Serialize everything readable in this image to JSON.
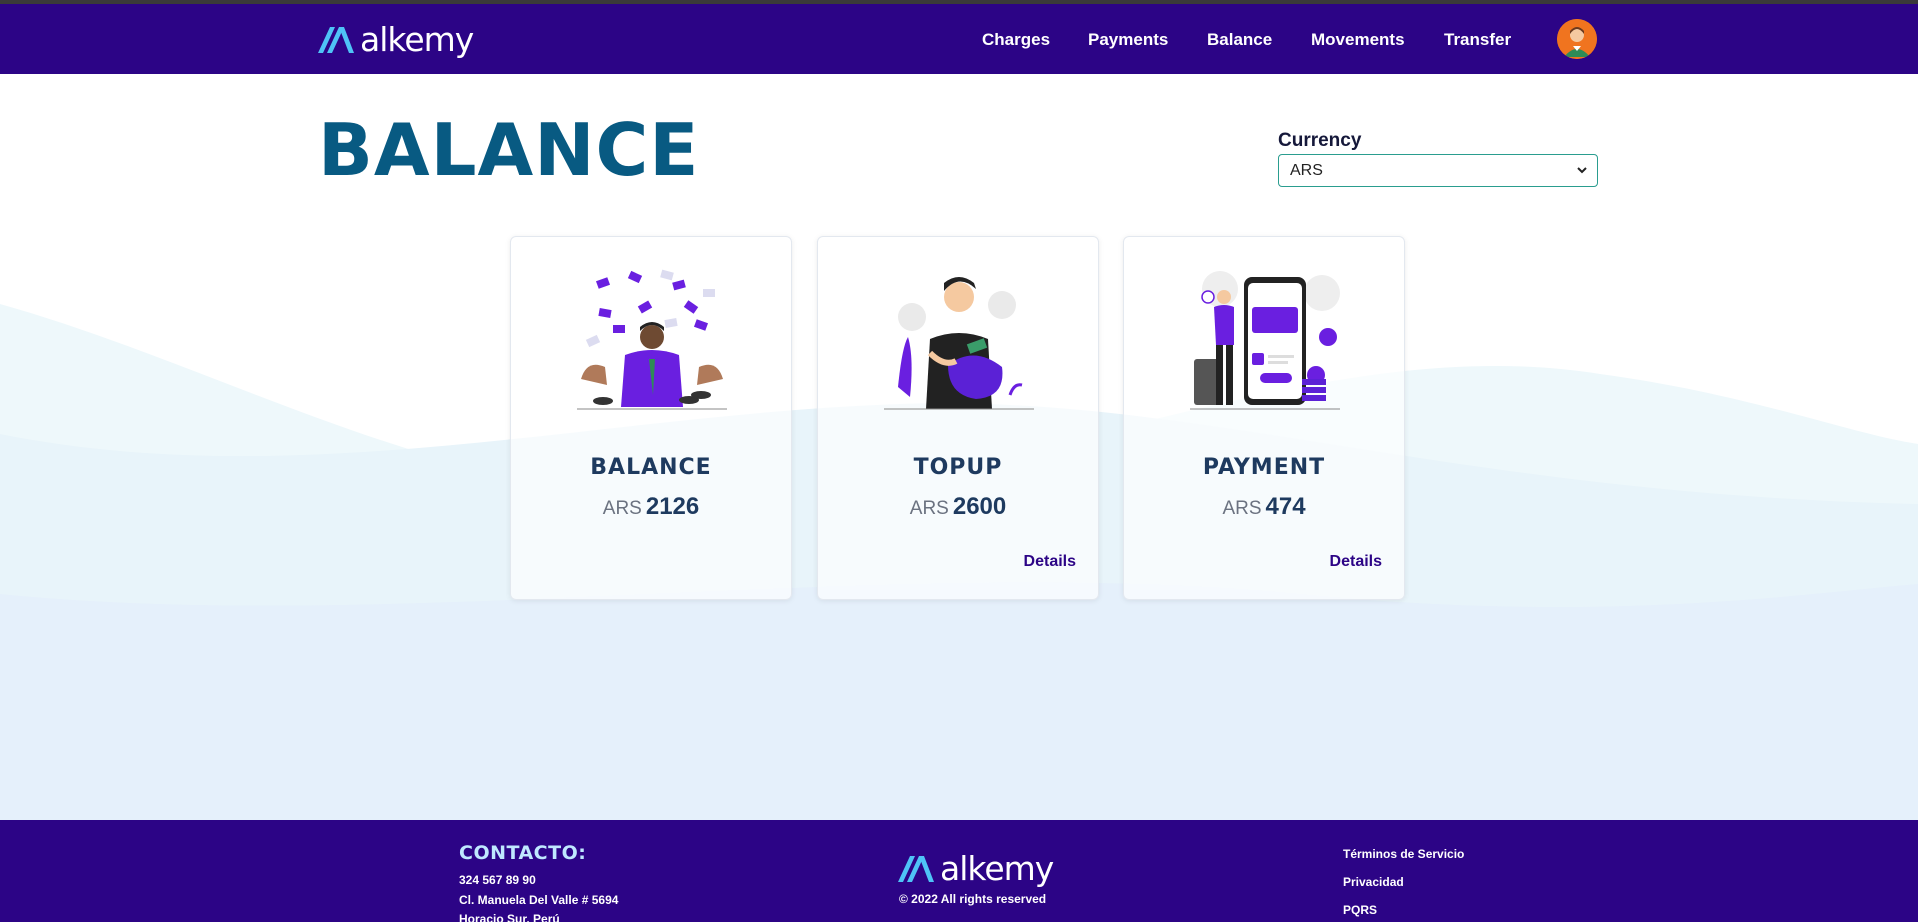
{
  "brand": {
    "name": "alkemy",
    "colors": {
      "navbar": "#2c0486",
      "title": "#085a82",
      "accent": "#4fc3f7"
    }
  },
  "nav": {
    "links": [
      {
        "label": "Charges"
      },
      {
        "label": "Payments"
      },
      {
        "label": "Balance"
      },
      {
        "label": "Movements"
      },
      {
        "label": "Transfer"
      }
    ],
    "avatar_icon": "user-avatar-icon"
  },
  "page": {
    "title": "BALANCE",
    "currency": {
      "label": "Currency",
      "selected": "ARS"
    }
  },
  "cards": [
    {
      "title": "BALANCE",
      "currency": "ARS",
      "amount": "2126",
      "icon": "money-rain-illustration"
    },
    {
      "title": "TOPUP",
      "currency": "ARS",
      "amount": "2600",
      "link": "Details",
      "icon": "piggy-bank-illustration"
    },
    {
      "title": "PAYMENT",
      "currency": "ARS",
      "amount": "474",
      "link": "Details",
      "icon": "mobile-payment-illustration"
    }
  ],
  "footer": {
    "contact_heading": "CONTACTO:",
    "contact_lines": [
      "324 567 89 90",
      "Cl. Manuela Del Valle # 5694",
      "Horacio Sur, Perú"
    ],
    "brand_name": "alkemy",
    "copyright": "© 2022 All rights reserved",
    "links": [
      {
        "label": "Términos de Servicio"
      },
      {
        "label": "Privacidad"
      },
      {
        "label": "PQRS"
      }
    ]
  }
}
